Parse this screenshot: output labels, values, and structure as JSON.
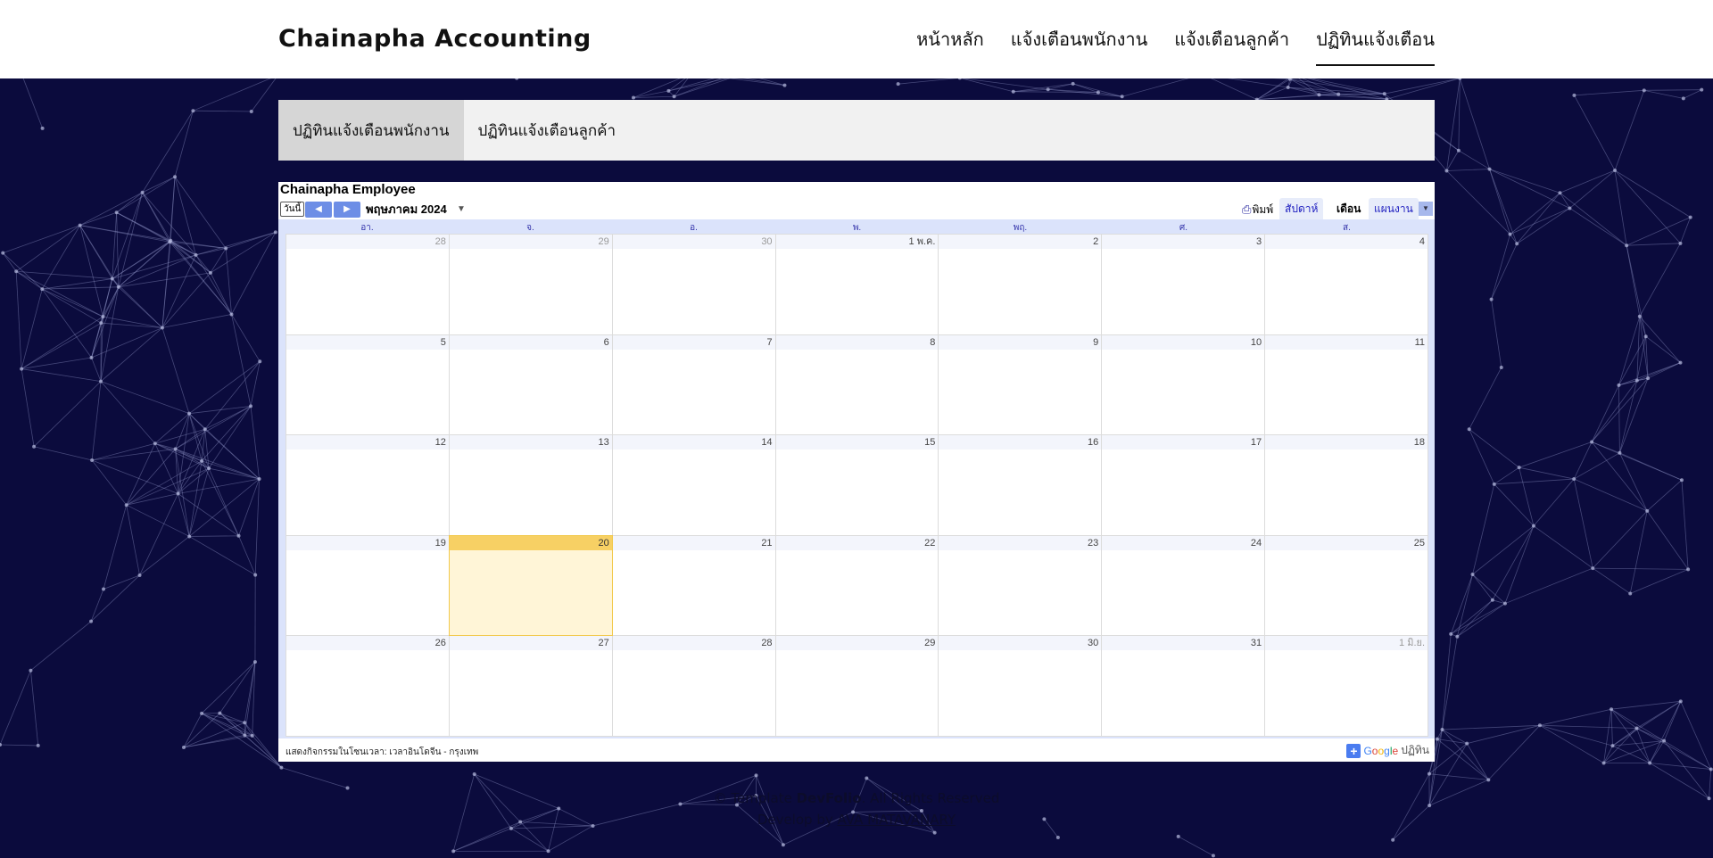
{
  "header": {
    "brand": "Chainapha Accounting",
    "nav": [
      {
        "label": "หน้าหลัก"
      },
      {
        "label": "แจ้งเตือนพนักงาน"
      },
      {
        "label": "แจ้งเตือนลูกค้า"
      },
      {
        "label": "ปฏิทินแจ้งเตือน",
        "active": true
      }
    ]
  },
  "tabs": [
    {
      "label": "ปฏิทินแจ้งเตือนพนักงาน",
      "active": true
    },
    {
      "label": "ปฏิทินแจ้งเตือนลูกค้า"
    }
  ],
  "calendar": {
    "title": "Chainapha Employee",
    "today_label": "วันนี้",
    "prev_icon": "chevron-left-icon",
    "next_icon": "chevron-right-icon",
    "month_label": "พฤษภาคม 2024",
    "print_label": "พิมพ์",
    "views": [
      {
        "label": "สัปดาห์"
      },
      {
        "label": "เดือน",
        "active": true
      },
      {
        "label": "แผนงาน"
      }
    ],
    "days_of_week": [
      "อา.",
      "จ.",
      "อ.",
      "พ.",
      "พฤ.",
      "ศ.",
      "ส."
    ],
    "weeks": [
      [
        {
          "d": "28",
          "other": true
        },
        {
          "d": "29",
          "other": true
        },
        {
          "d": "30",
          "other": true
        },
        {
          "d": "1 พ.ค."
        },
        {
          "d": "2"
        },
        {
          "d": "3"
        },
        {
          "d": "4"
        }
      ],
      [
        {
          "d": "5"
        },
        {
          "d": "6"
        },
        {
          "d": "7"
        },
        {
          "d": "8"
        },
        {
          "d": "9"
        },
        {
          "d": "10"
        },
        {
          "d": "11"
        }
      ],
      [
        {
          "d": "12"
        },
        {
          "d": "13"
        },
        {
          "d": "14"
        },
        {
          "d": "15"
        },
        {
          "d": "16"
        },
        {
          "d": "17"
        },
        {
          "d": "18"
        }
      ],
      [
        {
          "d": "19"
        },
        {
          "d": "20",
          "today": true
        },
        {
          "d": "21"
        },
        {
          "d": "22"
        },
        {
          "d": "23"
        },
        {
          "d": "24"
        },
        {
          "d": "25"
        }
      ],
      [
        {
          "d": "26"
        },
        {
          "d": "27"
        },
        {
          "d": "28"
        },
        {
          "d": "29"
        },
        {
          "d": "30"
        },
        {
          "d": "31"
        },
        {
          "d": "1 มิ.ย.",
          "other": true
        }
      ]
    ],
    "timezone_note": "แสดงกิจกรรมในโซนเวลา: เวลาอินโดจีน - กรุงเทพ",
    "google_badge": {
      "google": "Google",
      "label": "ปฏิทิน"
    },
    "colors": {
      "today_header": "#f7d064",
      "today_cell": "#fff5d7",
      "accent": "#6d8ee6"
    }
  },
  "footer": {
    "prefix": "© Template ",
    "template_name": "DevFolio",
    "suffix": ". All Rights Reserved",
    "develop_prefix": "Develop by ",
    "developer": "AVA MATAVANARY"
  },
  "colors": {
    "background": "#0b0b3d",
    "header_bg": "#ffffff"
  }
}
